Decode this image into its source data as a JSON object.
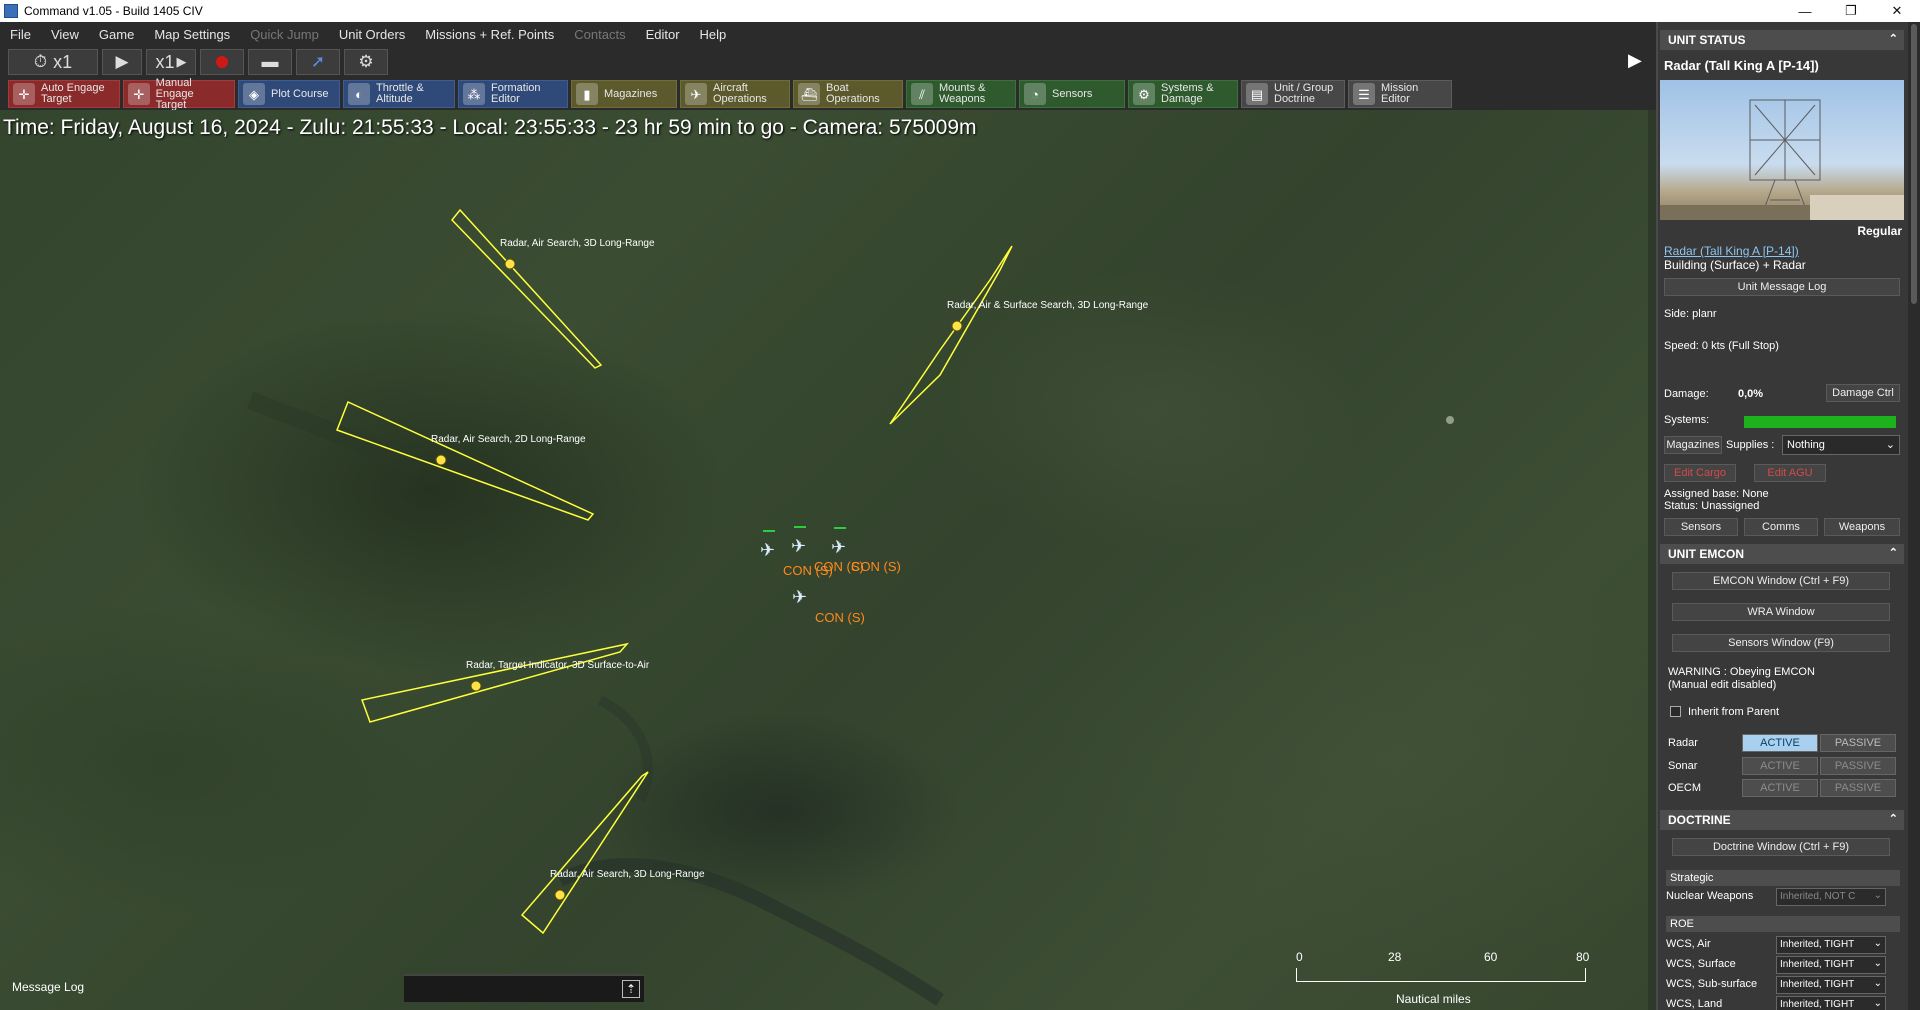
{
  "window": {
    "title": "Command v1.05 - Build 1405 CIV",
    "controls": [
      "—",
      "❐",
      "✕"
    ]
  },
  "menu": {
    "items": [
      {
        "label": "File",
        "enabled": true
      },
      {
        "label": "View",
        "enabled": true
      },
      {
        "label": "Game",
        "enabled": true
      },
      {
        "label": "Map Settings",
        "enabled": true
      },
      {
        "label": "Quick Jump",
        "enabled": false
      },
      {
        "label": "Unit Orders",
        "enabled": true
      },
      {
        "label": "Missions + Ref. Points",
        "enabled": true
      },
      {
        "label": "Contacts",
        "enabled": false
      },
      {
        "label": "Editor",
        "enabled": true
      },
      {
        "label": "Help",
        "enabled": true
      }
    ]
  },
  "sim": {
    "time_compression": "x1",
    "step_label": "x1"
  },
  "toolbar": {
    "buttons": [
      {
        "label": "Auto Engage\nTarget",
        "icon": "crosshair-icon",
        "color": "red"
      },
      {
        "label": "Manual\nEngage Target",
        "icon": "crosshair-icon",
        "color": "red"
      },
      {
        "label": "Plot Course",
        "icon": "compass-icon",
        "color": "blue"
      },
      {
        "label": "Throttle &\nAltitude",
        "icon": "throttle-icon",
        "color": "blue"
      },
      {
        "label": "Formation\nEditor",
        "icon": "formation-icon",
        "color": "blue"
      },
      {
        "label": "Magazines",
        "icon": "ammo-icon",
        "color": "olive"
      },
      {
        "label": "Aircraft\nOperations",
        "icon": "aircraft-icon",
        "color": "olive"
      },
      {
        "label": "Boat\nOperations",
        "icon": "boat-icon",
        "color": "olive"
      },
      {
        "label": "Mounts &\nWeapons",
        "icon": "weapons-icon",
        "color": "green"
      },
      {
        "label": "Sensors",
        "icon": "radar-icon",
        "color": "green"
      },
      {
        "label": "Systems &\nDamage",
        "icon": "gear-icon",
        "color": "green"
      },
      {
        "label": "Unit / Group\nDoctrine",
        "icon": "doctrine-icon",
        "color": "gray"
      },
      {
        "label": "Mission\nEditor",
        "icon": "mission-icon",
        "color": "gray"
      }
    ]
  },
  "map": {
    "status_line": "Time: Friday, August 16, 2024 - Zulu: 21:55:33 - Local: 23:55:33 - 23 hr 59 min to go -  Camera: 575009m",
    "radars": [
      {
        "label": "Radar, Air Search, 3D Long-Range"
      },
      {
        "label": "Radar, Air & Surface Search, 3D Long-Range"
      },
      {
        "label": "Radar, Air Search, 2D Long-Range"
      },
      {
        "label": "Radar, Target Indicator, 3D Surface-to-Air"
      },
      {
        "label": "Radar, Air Search, 3D Long-Range"
      }
    ],
    "contacts": [
      {
        "label": "CON (S)"
      },
      {
        "label": "CON (S)"
      },
      {
        "label": "CON (S)"
      },
      {
        "label": "CON (S)"
      }
    ],
    "scale": {
      "ticks": [
        "0",
        "28",
        "60",
        "80"
      ],
      "unit": "Nautical miles"
    },
    "message_log_label": "Message Log"
  },
  "unit_status": {
    "header": "UNIT STATUS",
    "unit_name": "Radar (Tall King A [P-14])",
    "proficiency": "Regular",
    "unit_link": "Radar (Tall King A [P-14])",
    "unit_type": "Building (Surface) + Radar",
    "message_log_button": "Unit Message Log",
    "side": "Side: planr",
    "speed": "Speed: 0 kts (Full Stop)",
    "damage_label": "Damage:",
    "damage_value": "0,0%",
    "damage_button": "Damage Ctrl",
    "systems_label": "Systems:",
    "systems_health": 1.0,
    "magazines_button": "Magazines",
    "supplies_label": "Supplies :",
    "supplies_value": "Nothing",
    "edit_cargo": "Edit Cargo",
    "edit_agu": "Edit AGU",
    "assigned_base": "Assigned base: None",
    "status": "Status: Unassigned",
    "tabs": [
      "Sensors",
      "Comms",
      "Weapons"
    ]
  },
  "emcon": {
    "header": "UNIT EMCON",
    "emcon_window": "EMCON Window (Ctrl + F9)",
    "wra_window": "WRA Window",
    "sensors_window": "Sensors Window (F9)",
    "warning": "WARNING : Obeying EMCON\n(Manual edit disabled)",
    "inherit_label": "Inherit from Parent",
    "rows": [
      {
        "label": "Radar",
        "active": "ACTIVE",
        "passive": "PASSIVE",
        "state": "active"
      },
      {
        "label": "Sonar",
        "active": "ACTIVE",
        "passive": "PASSIVE",
        "state": "none"
      },
      {
        "label": "OECM",
        "active": "ACTIVE",
        "passive": "PASSIVE",
        "state": "none"
      }
    ]
  },
  "doctrine": {
    "header": "DOCTRINE",
    "window_button": "Doctrine Window (Ctrl + F9)",
    "strategic_label": "Strategic",
    "nuclear_label": "Nuclear Weapons",
    "nuclear_value": "Inherited, NOT C",
    "roe_label": "ROE",
    "wcs": [
      {
        "label": "WCS, Air",
        "value": "Inherited, TIGHT"
      },
      {
        "label": "WCS, Surface",
        "value": "Inherited, TIGHT"
      },
      {
        "label": "WCS, Sub-surface",
        "value": "Inherited, TIGHT"
      },
      {
        "label": "WCS, Land",
        "value": "Inherited, TIGHT"
      }
    ]
  },
  "colors": {
    "radar_outline": "#ffff3c",
    "contact_label": "#ff8a1c",
    "aircraft_icon": "#d8ecff",
    "active_emcon": "#a9d1ef",
    "systems_bar": "#1db11d"
  }
}
